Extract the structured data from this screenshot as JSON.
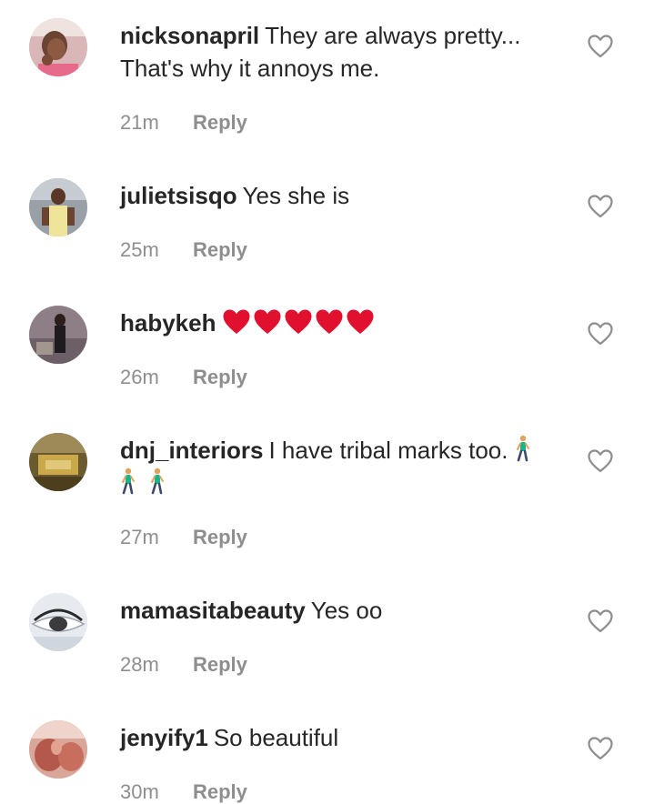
{
  "comments": [
    {
      "username": "nicksonapril",
      "text": "They are always pretty...",
      "text_line2": "That's why it annoys me.",
      "time": "21m",
      "reply_label": "Reply"
    },
    {
      "username": "julietsisqo",
      "text": "Yes she is",
      "time": "25m",
      "reply_label": "Reply"
    },
    {
      "username": "habykeh",
      "text": "❤❤❤❤❤",
      "time": "26m",
      "reply_label": "Reply"
    },
    {
      "username": "dnj_interiors",
      "text": "I have tribal marks too.",
      "emoji": "🚶🚶🚶",
      "time": "27m",
      "reply_label": "Reply"
    },
    {
      "username": "mamasitabeauty",
      "text": "Yes oo",
      "time": "28m",
      "reply_label": "Reply"
    },
    {
      "username": "jenyify1",
      "text": "So beautiful",
      "time": "30m",
      "reply_label": "Reply"
    }
  ],
  "icons": {
    "like": "heart-outline-icon",
    "walk": "person-walking-icon",
    "heart": "red-heart-icon"
  },
  "colors": {
    "primary_text": "#262626",
    "secondary_text": "#8e8e8e",
    "heart_red": "#e0102e"
  }
}
